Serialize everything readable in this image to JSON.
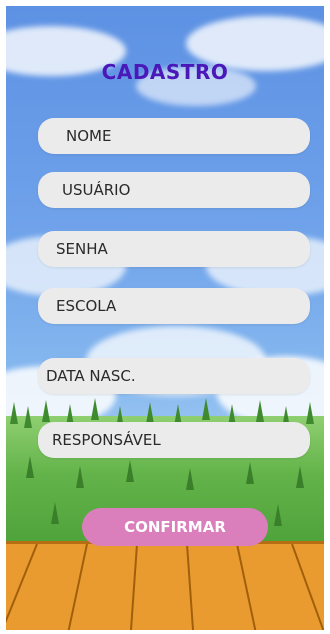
{
  "screen": {
    "title": "CADASTRO"
  },
  "form": {
    "fields": [
      {
        "label": "NOME"
      },
      {
        "label": "USUÁRIO"
      },
      {
        "label": "SENHA"
      },
      {
        "label": "ESCOLA"
      },
      {
        "label": "DATA NASC."
      },
      {
        "label": "RESPONSÁVEL"
      }
    ],
    "confirm_label": "CONFIRMAR"
  },
  "colors": {
    "title": "#4a18b8",
    "field_background": "#ebebeb",
    "confirm_button": "#db7ebc",
    "sky": "#6fa2ea",
    "grass": "#63b34a",
    "floor": "#e99b2f"
  }
}
